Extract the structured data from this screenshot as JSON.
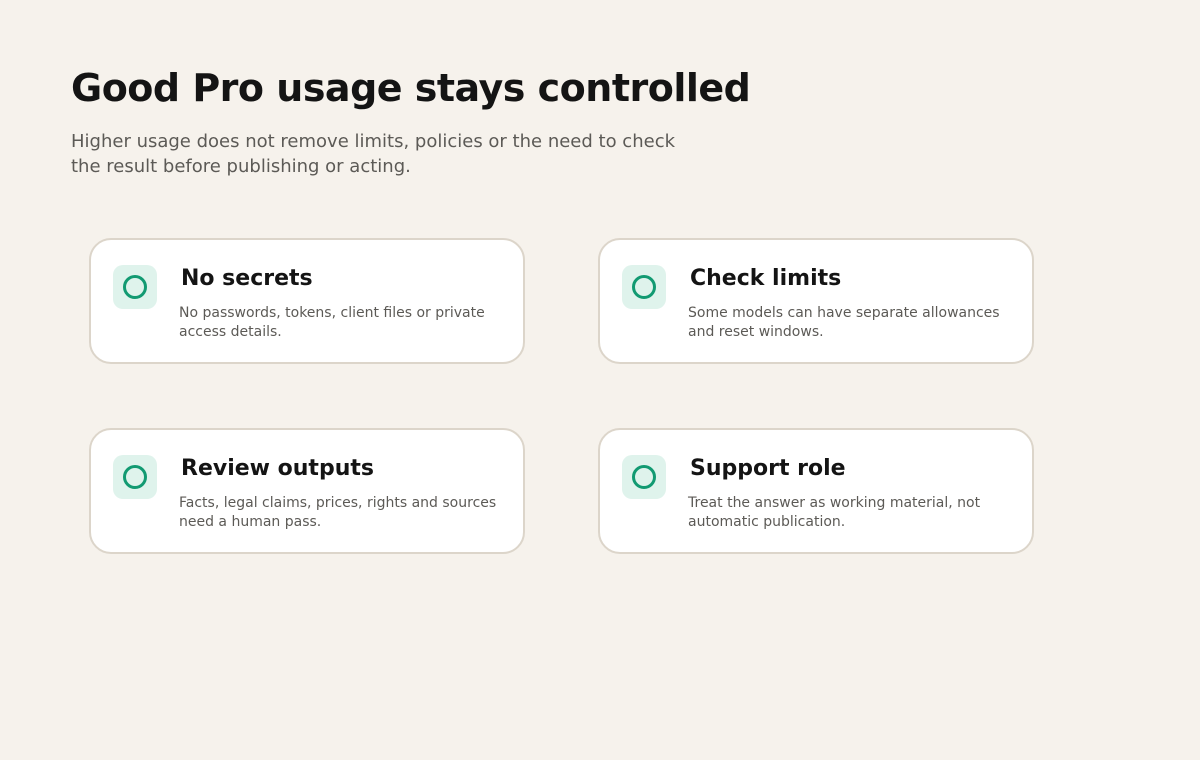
{
  "header": {
    "title": "Good Pro usage stays controlled",
    "subtitle": "Higher usage does not remove limits, policies or the need to check the result before publishing or acting."
  },
  "colors": {
    "background": "#f6f2ec",
    "card_background": "#ffffff",
    "card_border": "#dcd5ca",
    "icon_tile": "#dff3ec",
    "icon_accent": "#129a72"
  },
  "cards": [
    {
      "icon": "circle-icon",
      "title": "No secrets",
      "text": "No passwords, tokens, client files or private access details."
    },
    {
      "icon": "circle-icon",
      "title": "Check limits",
      "text": "Some models can have separate allowances and reset windows."
    },
    {
      "icon": "circle-icon",
      "title": "Review outputs",
      "text": "Facts, legal claims, prices, rights and sources need a human pass."
    },
    {
      "icon": "circle-icon",
      "title": "Support role",
      "text": "Treat the answer as working material, not automatic publication."
    }
  ]
}
